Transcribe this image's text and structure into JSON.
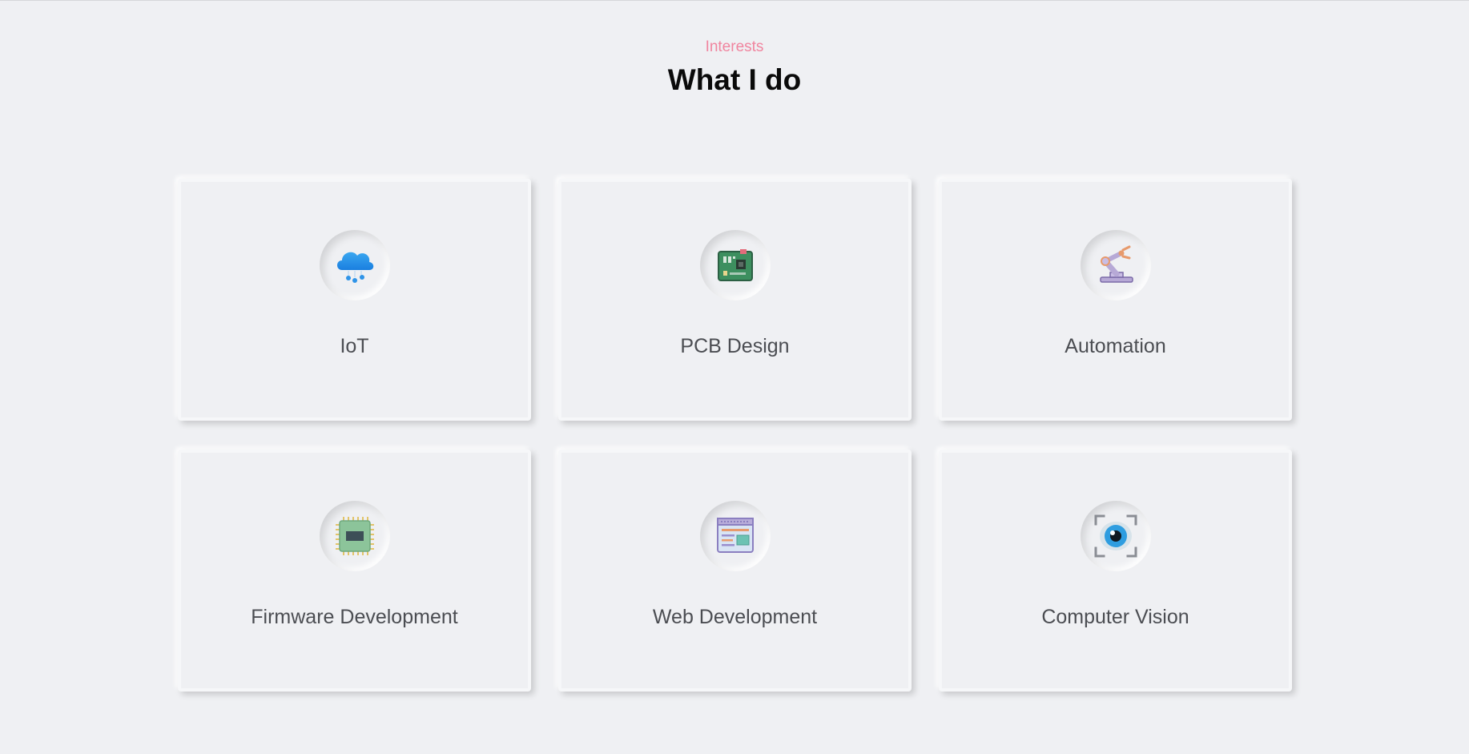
{
  "header": {
    "subtitle": "Interests",
    "title": "What I do"
  },
  "cards": [
    {
      "label": "IoT",
      "icon": "cloud-iot-icon"
    },
    {
      "label": "PCB Design",
      "icon": "circuit-board-icon"
    },
    {
      "label": "Automation",
      "icon": "robot-arm-icon"
    },
    {
      "label": "Firmware Development",
      "icon": "microchip-icon"
    },
    {
      "label": "Web Development",
      "icon": "web-page-icon"
    },
    {
      "label": "Computer Vision",
      "icon": "eye-scan-icon"
    }
  ],
  "colors": {
    "background": "#eff0f3",
    "accent": "#f0859f",
    "title": "#0a0a0a",
    "card_text": "#4b4d52"
  }
}
